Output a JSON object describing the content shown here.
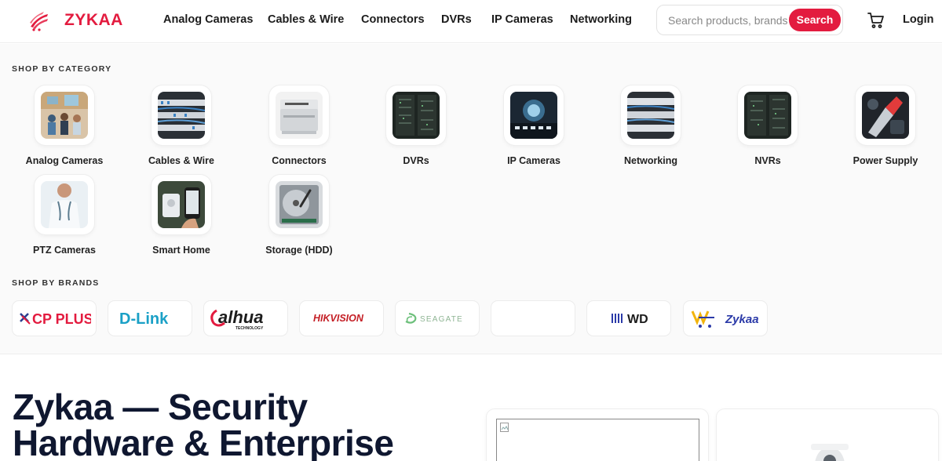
{
  "brand": {
    "name": "ZYKAA",
    "accent": "#e31b3f"
  },
  "nav": [
    "Analog Cameras",
    "Cables & Wire",
    "Connectors",
    "DVRs",
    "IP Cameras",
    "Networking"
  ],
  "search": {
    "placeholder": "Search products, brands",
    "button": "Search"
  },
  "header": {
    "login": "Login",
    "cart_icon": "cart-icon"
  },
  "categories_title": "SHOP BY CATEGORY",
  "categories": [
    "Analog Cameras",
    "Cables & Wire",
    "Connectors",
    "DVRs",
    "IP Cameras",
    "Networking",
    "NVRs",
    "Power Supply",
    "PTZ Cameras",
    "Smart Home",
    "Storage (HDD)"
  ],
  "brands_title": "SHOP BY BRANDS",
  "brands": [
    "CP PLUS",
    "D-Link",
    "alhua",
    "HIKVISION",
    "SEAGATE",
    "",
    "WD",
    "Zykaa"
  ],
  "brand_subtext": {
    "dahua": "TECHNOLOGY"
  },
  "hero": {
    "line1": "Zykaa — Security",
    "line2": "Hardware & Enterprise"
  }
}
